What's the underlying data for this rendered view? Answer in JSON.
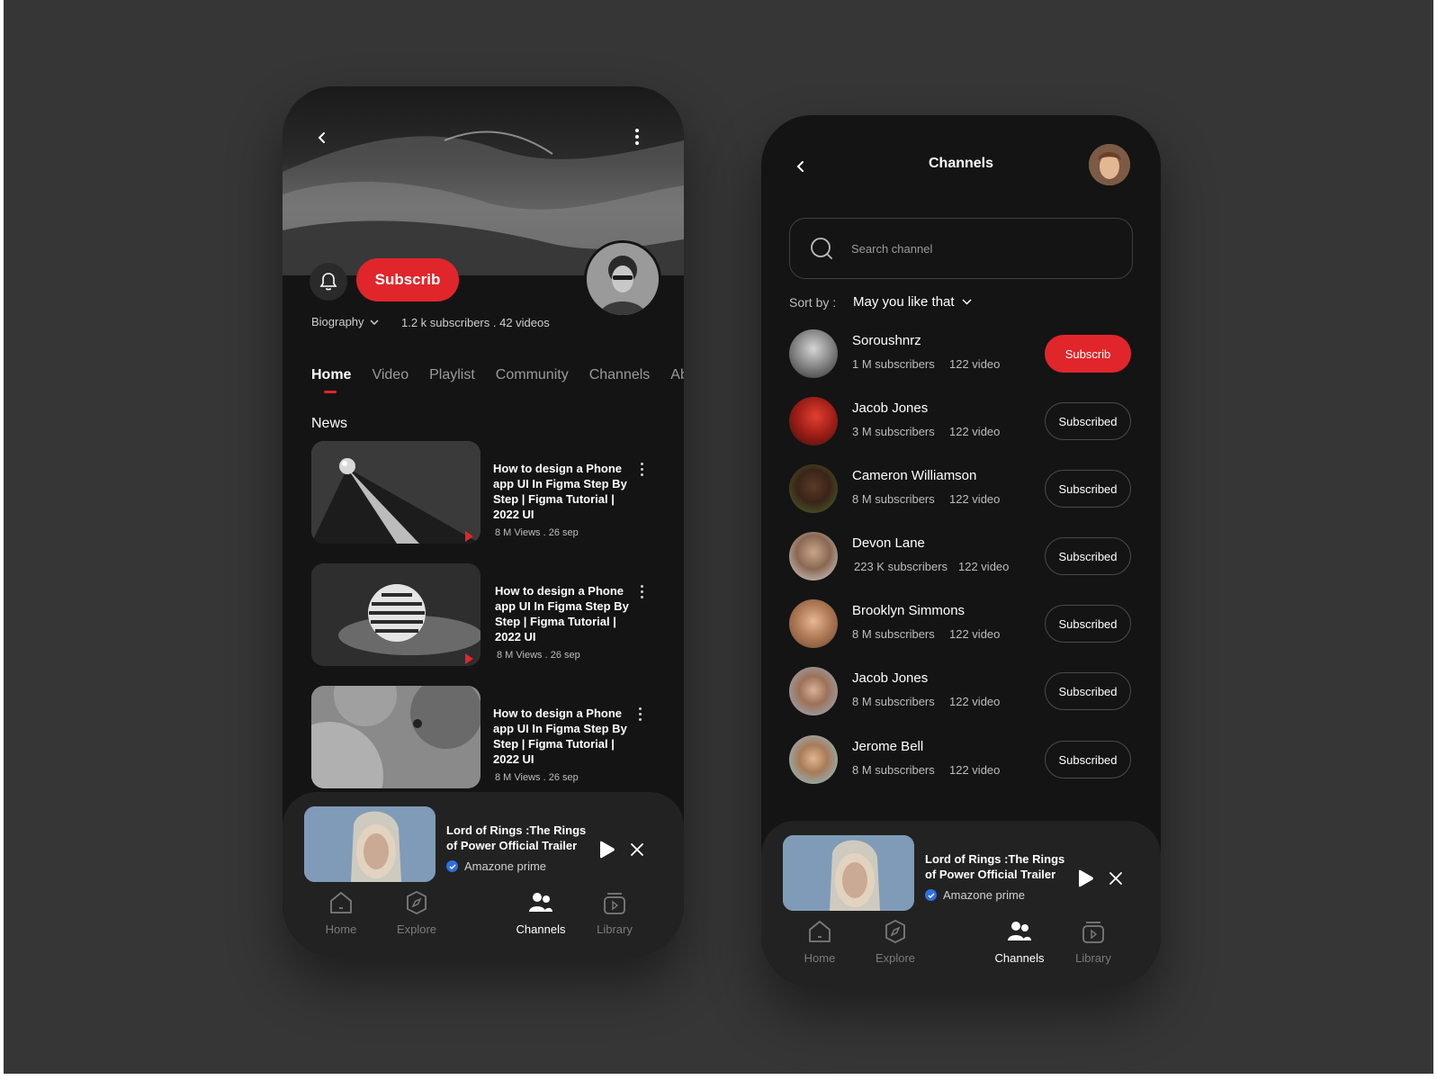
{
  "left_phone": {
    "header": {
      "back_icon": "chevron-left-icon",
      "more_icon": "more-vertical-icon"
    },
    "subscribe_label": "Subscrib",
    "biography_label": "Biography",
    "stats": "1.2 k subscribers . 42 videos",
    "tabs": [
      "Home",
      "Video",
      "Playlist",
      "Community",
      "Channels",
      "Ab"
    ],
    "active_tab": "Home",
    "section_title": "News",
    "videos": [
      {
        "title": "How to design a Phone app UI In Figma Step By Step | Figma Tutorial | 2022 UI",
        "meta": "8 M Views . 26 sep"
      },
      {
        "title": "How to design a Phone app UI In Figma Step By Step | Figma Tutorial | 2022 UI",
        "meta": "8 M Views . 26 sep"
      },
      {
        "title": "How to design a Phone app UI In Figma Step By Step | Figma Tutorial | 2022 UI",
        "meta": "8 M Views . 26 sep"
      }
    ]
  },
  "mini_player": {
    "title": "Lord of Rings :The Rings of Power Official Trailer",
    "channel": "Amazone prime"
  },
  "nav": {
    "items": [
      "Home",
      "Explore",
      "Channels",
      "Library"
    ],
    "active": "Channels"
  },
  "right_phone": {
    "title": "Channels",
    "search_placeholder": "Search channel",
    "sort_label": "Sort by :",
    "sort_value": "May you like that",
    "channels": [
      {
        "name": "Soroushnrz",
        "subscribers": "1 M subscribers",
        "videos": "122 video",
        "button": "Subscrib",
        "subscribed": false
      },
      {
        "name": "Jacob Jones",
        "subscribers": "3 M subscribers",
        "videos": "122 video",
        "button": "Subscribed",
        "subscribed": true
      },
      {
        "name": "Cameron Williamson",
        "subscribers": "8 M subscribers",
        "videos": "122 video",
        "button": "Subscribed",
        "subscribed": true
      },
      {
        "name": "Devon Lane",
        "subscribers": "223 K subscribers",
        "videos": "122 video",
        "button": "Subscribed",
        "subscribed": true
      },
      {
        "name": "Brooklyn Simmons",
        "subscribers": "8 M subscribers",
        "videos": "122 video",
        "button": "Subscribed",
        "subscribed": true
      },
      {
        "name": "Jacob Jones",
        "subscribers": "8 M subscribers",
        "videos": "122 video",
        "button": "Subscribed",
        "subscribed": true
      },
      {
        "name": "Jerome Bell",
        "subscribers": "8 M subscribers",
        "videos": "122 video",
        "button": "Subscribed",
        "subscribed": true
      }
    ]
  },
  "colors": {
    "accent": "#e0262b",
    "background": "#363636",
    "phone": "#141414",
    "verified": "#2f6fe0"
  }
}
